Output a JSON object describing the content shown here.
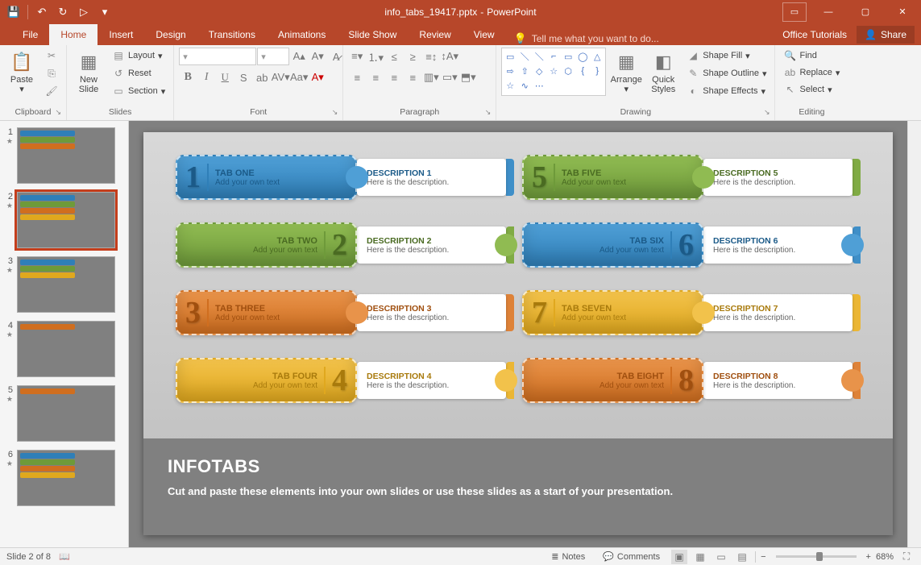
{
  "title": {
    "filename": "info_tabs_19417.pptx",
    "app": "PowerPoint"
  },
  "qat": {
    "save": "💾",
    "undo": "↶",
    "redo": "↻",
    "start": "▷"
  },
  "tabs": {
    "file": "File",
    "home": "Home",
    "insert": "Insert",
    "design": "Design",
    "transitions": "Transitions",
    "animations": "Animations",
    "slideshow": "Slide Show",
    "review": "Review",
    "view": "View",
    "tellme": "Tell me what you want to do...",
    "tutorials": "Office Tutorials",
    "share": "Share"
  },
  "ribbon": {
    "clipboard": {
      "label": "Clipboard",
      "paste": "Paste",
      "cut": "✂",
      "copy": "⎘",
      "fmtpaint": "🖌"
    },
    "slides": {
      "label": "Slides",
      "newslide": "New\nSlide",
      "layout": "Layout",
      "reset": "Reset",
      "section": "Section"
    },
    "font": {
      "label": "Font"
    },
    "paragraph": {
      "label": "Paragraph"
    },
    "drawing": {
      "label": "Drawing",
      "arrange": "Arrange",
      "quickstyles": "Quick\nStyles",
      "shapefill": "Shape Fill",
      "shapeoutline": "Shape Outline",
      "shapeeffects": "Shape Effects"
    },
    "editing": {
      "label": "Editing",
      "find": "Find",
      "replace": "Replace",
      "select": "Select"
    }
  },
  "thumbs": {
    "count": 6,
    "selected": 2
  },
  "slide": {
    "tabs": [
      {
        "num": "1",
        "ttl": "TAB ONE",
        "sub": "Add your own text",
        "dttl": "DESCRIPTION 1",
        "dsub": "Here is the description.",
        "color": "blue",
        "align": "left"
      },
      {
        "num": "5",
        "ttl": "TAB FIVE",
        "sub": "Add your own text",
        "dttl": "DESCRIPTION 5",
        "dsub": "Here is the description.",
        "color": "green",
        "align": "left"
      },
      {
        "num": "2",
        "ttl": "TAB TWO",
        "sub": "Add your own text",
        "dttl": "DESCRIPTION 2",
        "dsub": "Here is the description.",
        "color": "green",
        "align": "right"
      },
      {
        "num": "6",
        "ttl": "TAB SIX",
        "sub": "Add your own text",
        "dttl": "DESCRIPTION 6",
        "dsub": "Here is the description.",
        "color": "blue",
        "align": "right"
      },
      {
        "num": "3",
        "ttl": "TAB THREE",
        "sub": "Add your own text",
        "dttl": "DESCRIPTION 3",
        "dsub": "Here is the description.",
        "color": "orange",
        "align": "left"
      },
      {
        "num": "7",
        "ttl": "TAB SEVEN",
        "sub": "Add your own text",
        "dttl": "DESCRIPTION 7",
        "dsub": "Here is the description.",
        "color": "yellow",
        "align": "left"
      },
      {
        "num": "4",
        "ttl": "TAB FOUR",
        "sub": "Add your own text",
        "dttl": "DESCRIPTION 4",
        "dsub": "Here is the description.",
        "color": "yellow",
        "align": "right"
      },
      {
        "num": "8",
        "ttl": "TAB EIGHT",
        "sub": "Add your own text",
        "dttl": "DESCRIPTION 8",
        "dsub": "Here is the description.",
        "color": "orange",
        "align": "right"
      }
    ],
    "footer": {
      "title": "INFOTABS",
      "sub": "Cut and paste these elements into your own slides or use these slides as a start of your presentation."
    }
  },
  "status": {
    "slide": "Slide 2 of 8",
    "notes": "Notes",
    "comments": "Comments",
    "zoom": "68%",
    "plus": "+",
    "minus": "−"
  }
}
